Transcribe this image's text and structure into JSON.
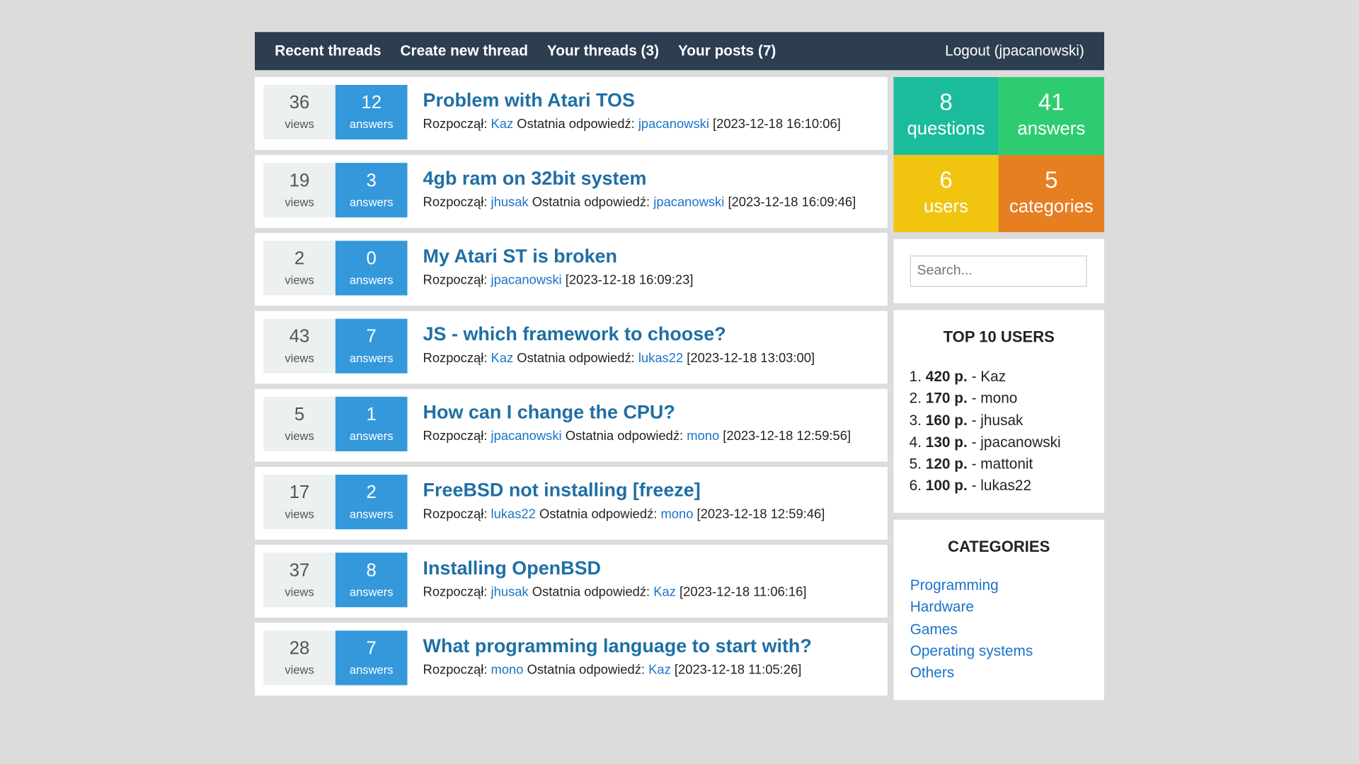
{
  "nav": {
    "recent": "Recent threads",
    "create": "Create new thread",
    "your_threads": "Your threads (3)",
    "your_posts": "Your posts (7)",
    "logout": "Logout (jpacanowski)"
  },
  "labels": {
    "views": "views",
    "answers": "answers",
    "started": "Rozpoczął:",
    "last": "Ostatnia odpowiedź:"
  },
  "threads": [
    {
      "views": "36",
      "answers": "12",
      "title": "Problem with Atari TOS",
      "author": "Kaz",
      "last": "jpacanowski",
      "date": "[2023-12-18 16:10:06]"
    },
    {
      "views": "19",
      "answers": "3",
      "title": "4gb ram on 32bit system",
      "author": "jhusak",
      "last": "jpacanowski",
      "date": "[2023-12-18 16:09:46]"
    },
    {
      "views": "2",
      "answers": "0",
      "title": "My Atari ST is broken",
      "author": "jpacanowski",
      "last": null,
      "date": "[2023-12-18 16:09:23]"
    },
    {
      "views": "43",
      "answers": "7",
      "title": "JS - which framework to choose?",
      "author": "Kaz",
      "last": "lukas22",
      "date": "[2023-12-18 13:03:00]"
    },
    {
      "views": "5",
      "answers": "1",
      "title": "How can I change the CPU?",
      "author": "jpacanowski",
      "last": "mono",
      "date": "[2023-12-18 12:59:56]"
    },
    {
      "views": "17",
      "answers": "2",
      "title": "FreeBSD not installing [freeze]",
      "author": "lukas22",
      "last": "mono",
      "date": "[2023-12-18 12:59:46]"
    },
    {
      "views": "37",
      "answers": "8",
      "title": "Installing OpenBSD",
      "author": "jhusak",
      "last": "Kaz",
      "date": "[2023-12-18 11:06:16]"
    },
    {
      "views": "28",
      "answers": "7",
      "title": "What programming language to start with?",
      "author": "mono",
      "last": "Kaz",
      "date": "[2023-12-18 11:05:26]"
    }
  ],
  "stats": [
    {
      "n": "8",
      "l": "questions",
      "color": "#1abc9c"
    },
    {
      "n": "41",
      "l": "answers",
      "color": "#2ecc71"
    },
    {
      "n": "6",
      "l": "users",
      "color": "#f1c40f"
    },
    {
      "n": "5",
      "l": "categories",
      "color": "#e67e22"
    }
  ],
  "search": {
    "placeholder": "Search..."
  },
  "top_users": {
    "title": "TOP 10 USERS",
    "items": [
      {
        "points": "420 p.",
        "name": "Kaz"
      },
      {
        "points": "170 p.",
        "name": "mono"
      },
      {
        "points": "160 p.",
        "name": "jhusak"
      },
      {
        "points": "130 p.",
        "name": "jpacanowski"
      },
      {
        "points": "120 p.",
        "name": "mattonit"
      },
      {
        "points": "100 p.",
        "name": "lukas22"
      }
    ]
  },
  "categories": {
    "title": "CATEGORIES",
    "items": [
      "Programming",
      "Hardware",
      "Games",
      "Operating systems",
      "Others"
    ]
  }
}
